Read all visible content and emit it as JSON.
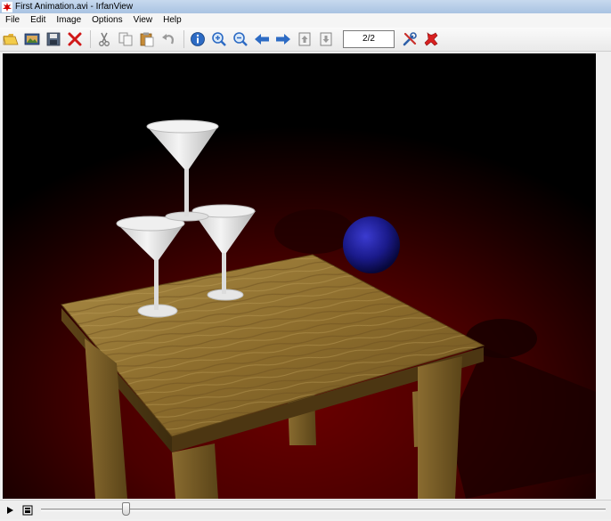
{
  "window": {
    "title": "First Animation.avi - IrfanView"
  },
  "menu": [
    "File",
    "Edit",
    "Image",
    "Options",
    "View",
    "Help"
  ],
  "toolbar": {
    "buttons": [
      "open-icon",
      "thumbnails-icon",
      "save-icon",
      "delete-icon",
      "cut-icon",
      "copy-icon",
      "paste-icon",
      "undo-icon",
      "info-icon",
      "zoom-in-icon",
      "zoom-out-icon",
      "prev-icon",
      "next-icon",
      "first-page-icon",
      "last-page-icon",
      "settings-icon",
      "exit-icon"
    ],
    "page_indicator": "2/2"
  },
  "player": {
    "play_icon": "play-icon",
    "frame_icon": "frame-icon",
    "position": 0.15
  },
  "colors": {
    "floor": "#5a0000",
    "table_wood": "#9a7a34",
    "sphere": "#1a1a8a",
    "glass": "#e8e8e8"
  }
}
